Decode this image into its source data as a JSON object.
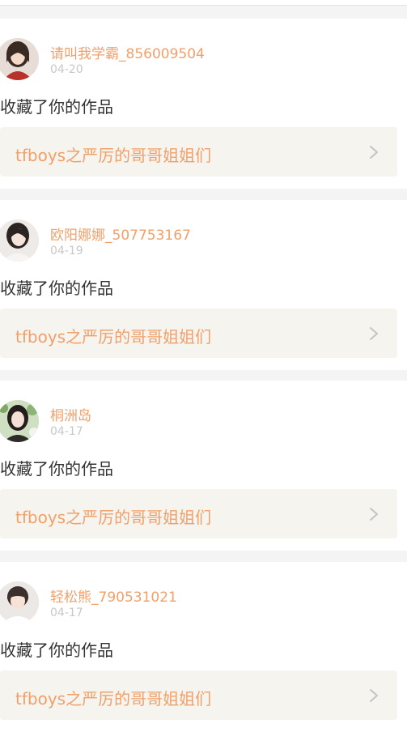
{
  "feed": {
    "items": [
      {
        "username": "请叫我学霸_856009504",
        "date": "04-20",
        "action": "收藏了你的作品",
        "work_title": "tfboys之严厉的哥哥姐姐们",
        "avatar_icon": "avatar-girl-red-dress",
        "avatar_color": "#c9a99a"
      },
      {
        "username": "欧阳娜娜_507753167",
        "date": "04-19",
        "action": "收藏了你的作品",
        "work_title": "tfboys之严厉的哥哥姐姐们",
        "avatar_icon": "avatar-girl-white",
        "avatar_color": "#d8d3cf"
      },
      {
        "username": "桐洲岛",
        "date": "04-17",
        "action": "收藏了你的作品",
        "work_title": "tfboys之严厉的哥哥姐姐们",
        "avatar_icon": "avatar-girl-flowers",
        "avatar_color": "#9dbb8a"
      },
      {
        "username": "轻松熊_790531021",
        "date": "04-17",
        "action": "收藏了你的作品",
        "work_title": "tfboys之严厉的哥哥姐姐们",
        "avatar_icon": "avatar-boy",
        "avatar_color": "#d9d6d2"
      }
    ]
  },
  "colors": {
    "accent": "#f0a06a",
    "date": "#c8c8c8",
    "text": "#333333",
    "card_link_bg": "#f5f4ee",
    "background": "#f4f4f4"
  }
}
